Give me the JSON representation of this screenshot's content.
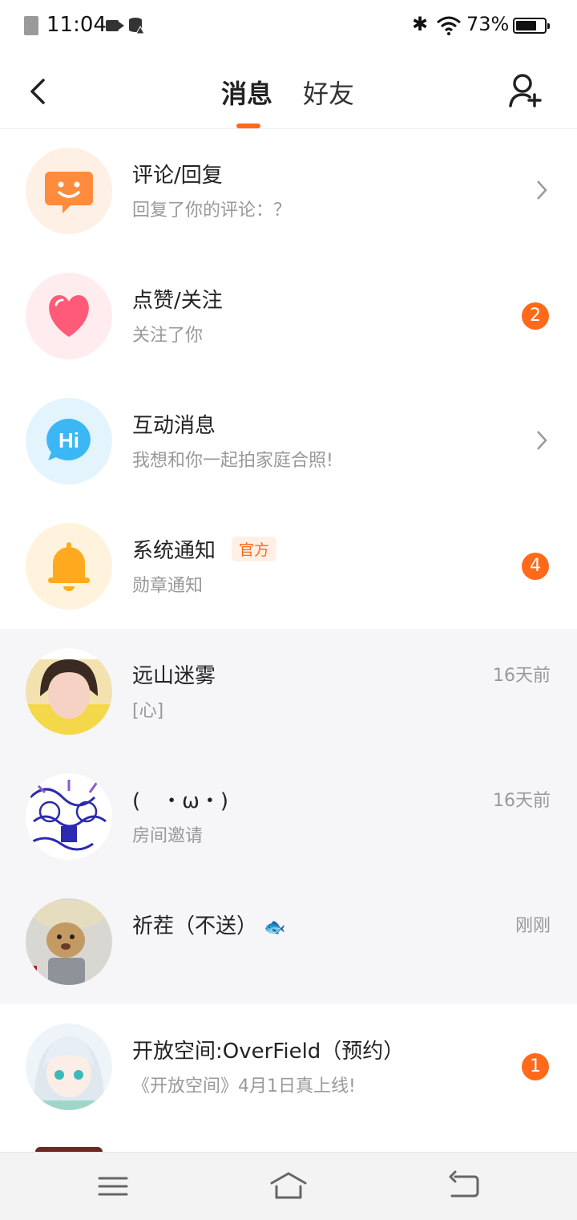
{
  "status_bar": {
    "time": "11:04",
    "battery_percent": "73%",
    "battery_level": 0.73,
    "icons": [
      "sim-absent-icon",
      "video-camera-icon",
      "data-icon",
      "bluetooth-icon",
      "wifi-icon",
      "battery-icon"
    ]
  },
  "header": {
    "tabs": [
      {
        "label": "消息",
        "active": true
      },
      {
        "label": "好友",
        "active": false
      }
    ],
    "back_icon": "chevron-left-icon",
    "add_friend_icon": "add-user-icon",
    "accent_color": "#ff6a1a"
  },
  "notifications": [
    {
      "title": "评论/回复",
      "subtitle": "回复了你的评论：？",
      "icon": "comment-smile-icon",
      "icon_color": "#ff8b3d",
      "bg_color": "#fff0e6",
      "trailing": "chevron"
    },
    {
      "title": "点赞/关注",
      "subtitle": "关注了你",
      "icon": "heart-icon",
      "icon_color": "#ff5a78",
      "bg_color": "#ffecee",
      "trailing": "badge",
      "badge": "2"
    },
    {
      "title": "互动消息",
      "subtitle": "我想和你一起拍家庭合照!",
      "icon": "hi-bubble-icon",
      "icon_color": "#3bb7f5",
      "bg_color": "#e3f4fd",
      "trailing": "chevron"
    },
    {
      "title": "系统通知",
      "tag": "官方",
      "subtitle": "勋章通知",
      "icon": "bell-icon",
      "icon_color": "#ffaa1e",
      "bg_color": "#fff3dd",
      "trailing": "badge",
      "badge": "4"
    }
  ],
  "chats": [
    {
      "name": "远山迷雾",
      "preview": "[心]",
      "time": "16天前",
      "avatar": "girl-photo-avatar"
    },
    {
      "name": "(　・ω・)",
      "preview": "房间邀请",
      "time": "16天前",
      "avatar": "sketch-art-avatar"
    },
    {
      "name": "祈茬（不送）",
      "name_emoji": "🐟",
      "preview": "",
      "time": "刚刚",
      "avatar": "cat-photo-avatar"
    },
    {
      "name": "开放空间:OverField（预约）",
      "preview": "《开放空间》4月1日真上线!",
      "badge": "1",
      "avatar": "anime-girl-avatar"
    }
  ],
  "nav_bar": {
    "buttons": [
      "menu-icon",
      "home-icon",
      "back-icon"
    ]
  }
}
